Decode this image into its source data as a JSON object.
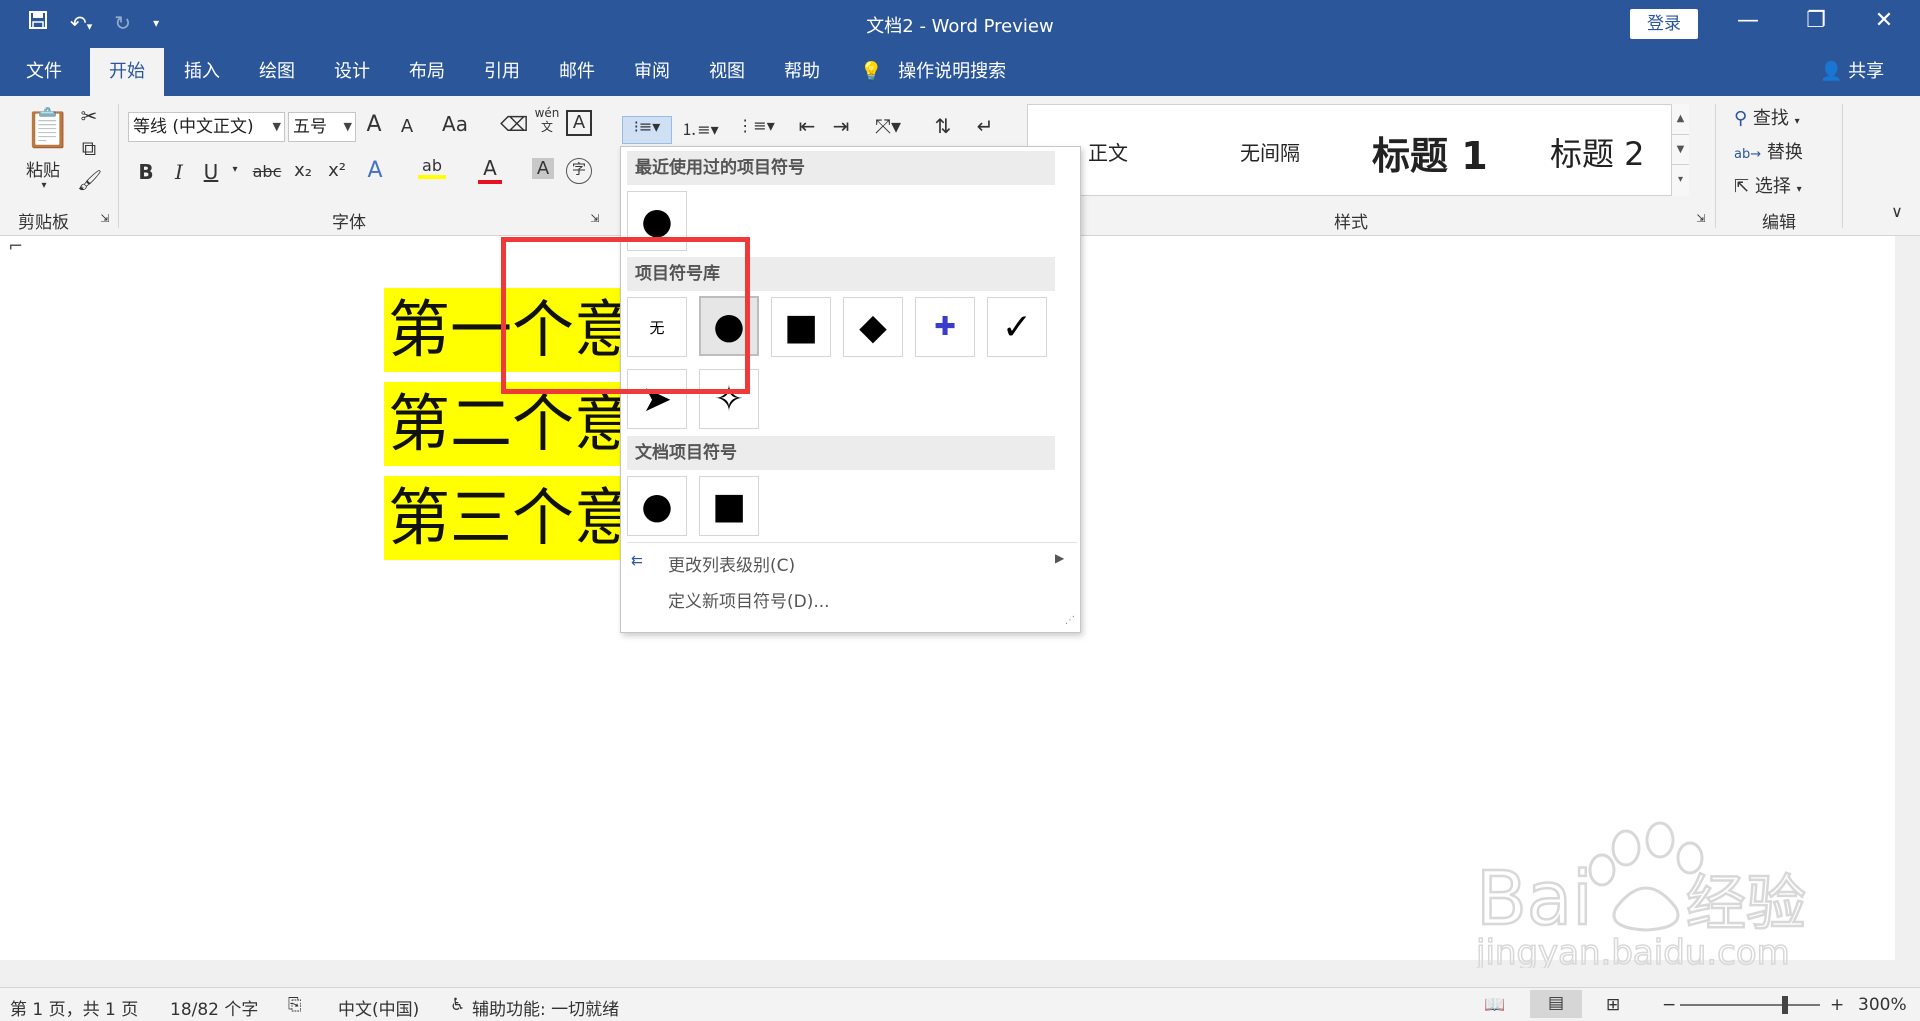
{
  "window": {
    "title": "文档2 - Word Preview",
    "login_label": "登录"
  },
  "tabs": [
    "文件",
    "开始",
    "插入",
    "绘图",
    "设计",
    "布局",
    "引用",
    "邮件",
    "审阅",
    "视图",
    "帮助"
  ],
  "active_tab": "开始",
  "tell_me": "操作说明搜索",
  "share_label": "共享",
  "ribbon": {
    "clipboard": {
      "label": "剪贴板",
      "paste": "粘贴"
    },
    "font": {
      "label": "字体",
      "font_name": "等线 (中文正文)",
      "font_size": "五号",
      "grow": "A",
      "shrink": "A",
      "change_case": "Aa",
      "phonetic": "wén文",
      "border_char": "A",
      "bold": "B",
      "italic": "I",
      "underline": "U",
      "strike": "abc",
      "subscript": "x₂",
      "superscript": "x²",
      "text_effect": "A",
      "highlight": "ab",
      "font_color": "A",
      "shading": "A",
      "enclose": "字",
      "font_color_hex": "#e81123",
      "highlight_hex": "#ffff00"
    },
    "styles": {
      "label": "样式",
      "items": [
        "正文",
        "无间隔",
        "标题 1",
        "标题 2"
      ]
    },
    "editing": {
      "label": "编辑",
      "find": "查找",
      "replace": "替换",
      "select": "选择"
    }
  },
  "document": {
    "lines": [
      "第一个意",
      "第二个意",
      "第三个意"
    ],
    "highlight_color": "#ffff00"
  },
  "bullet_dropdown": {
    "recent_header": "最近使用过的项目符号",
    "library_header": "项目符号库",
    "document_header": "文档项目符号",
    "recent": [
      "●"
    ],
    "library": [
      "无",
      "●",
      "■",
      "◆",
      "✚",
      "✓",
      "➤",
      "✧"
    ],
    "document": [
      "●",
      "■"
    ],
    "change_level": "更改列表级别(C)",
    "define_new": "定义新项目符号(D)..."
  },
  "status": {
    "page": "第 1 页，共 1 页",
    "words": "18/82 个字",
    "language": "中文(中国)",
    "accessibility": "辅助功能: 一切就绪",
    "zoom": "300%"
  },
  "accent_color": "#2b579a",
  "annotation_color": "#f03a3a"
}
